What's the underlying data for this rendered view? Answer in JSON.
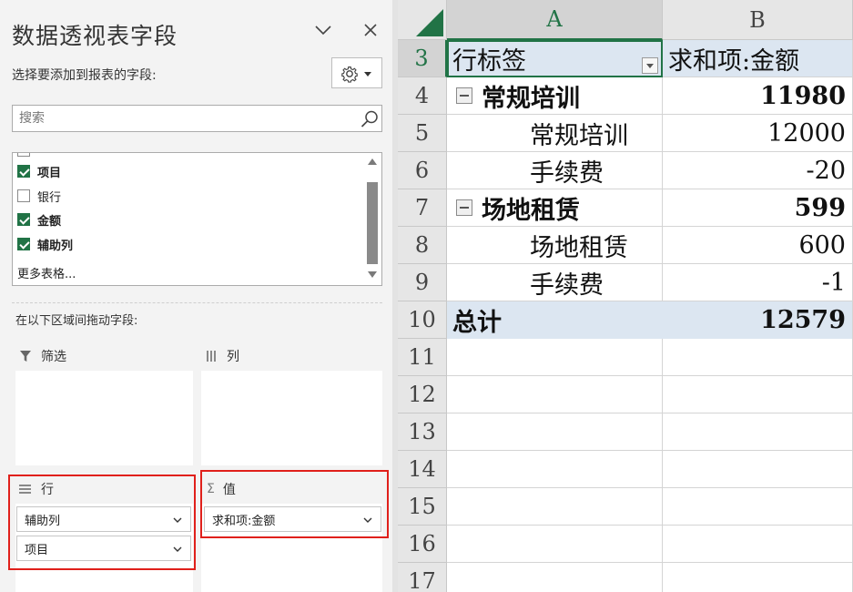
{
  "pane": {
    "title": "数据透视表字段",
    "choose_label": "选择要添加到报表的字段:",
    "search_placeholder": "搜索",
    "fields": [
      {
        "label": "项目",
        "checked": true
      },
      {
        "label": "银行",
        "checked": false
      },
      {
        "label": "金额",
        "checked": true
      },
      {
        "label": "辅助列",
        "checked": true
      }
    ],
    "more_tables": "更多表格...",
    "drag_label": "在以下区域间拖动字段:",
    "areas": {
      "filter": {
        "label": "筛选"
      },
      "columns": {
        "label": "列"
      },
      "rows": {
        "label": "行",
        "items": [
          "辅助列",
          "项目"
        ]
      },
      "values": {
        "label": "值",
        "items": [
          "求和项:金额"
        ]
      }
    },
    "accent_color": "#217346",
    "highlight_color": "#e0201b"
  },
  "sheet": {
    "columns": [
      "A",
      "B"
    ],
    "row_numbers": [
      "3",
      "4",
      "5",
      "6",
      "7",
      "8",
      "9",
      "10",
      "11",
      "12",
      "13",
      "14",
      "15",
      "16",
      "17"
    ],
    "header": {
      "row_label": "行标签",
      "value_label": "求和项:金额"
    },
    "groups": [
      {
        "label": "常规培训",
        "total": "11980",
        "items": [
          {
            "label": "常规培训",
            "value": "12000"
          },
          {
            "label": "手续费",
            "value": "-20"
          }
        ]
      },
      {
        "label": "场地租赁",
        "total": "599",
        "items": [
          {
            "label": "场地租赁",
            "value": "600"
          },
          {
            "label": "手续费",
            "value": "-1"
          }
        ]
      }
    ],
    "grand_total": {
      "label": "总计",
      "value": "12579"
    },
    "header_fill": "#dce6f1"
  }
}
